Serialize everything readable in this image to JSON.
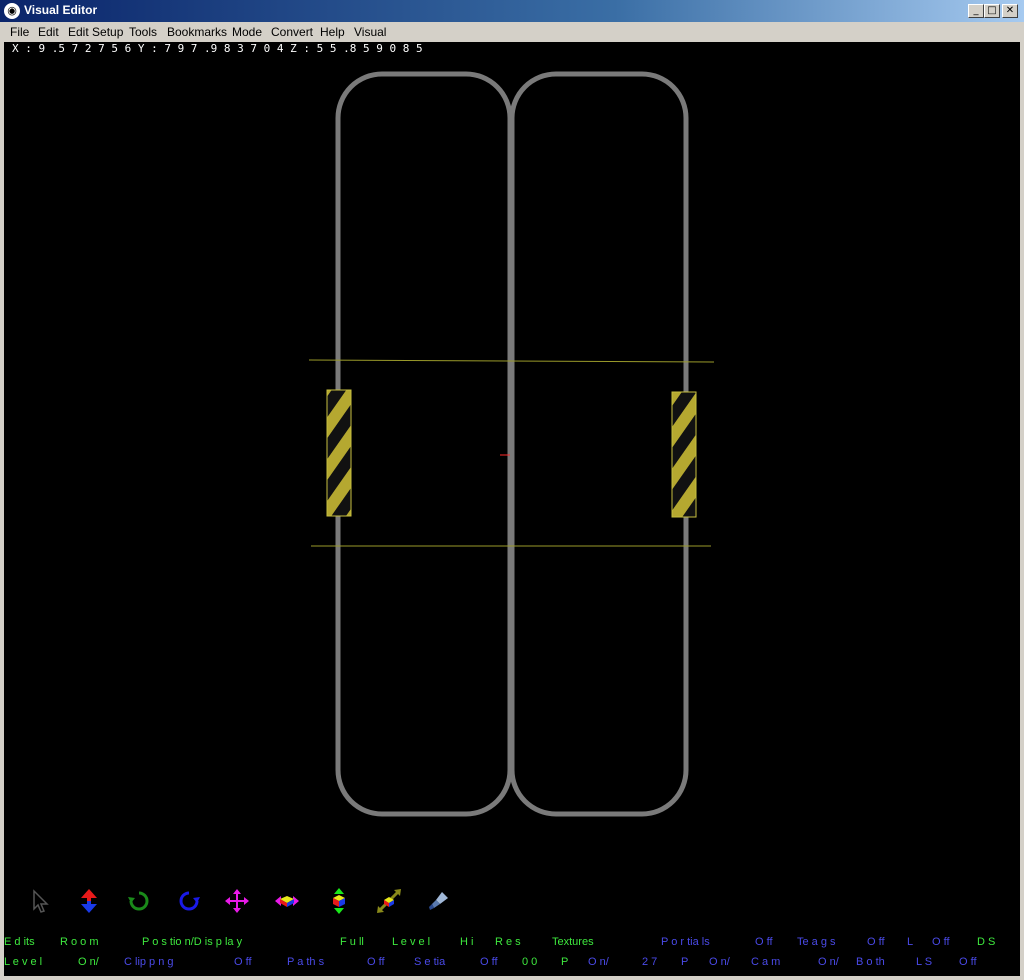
{
  "window": {
    "title": "Visual Editor",
    "minimize": "_",
    "maximize": "□",
    "close": "✕"
  },
  "menu": [
    "File",
    "Edit",
    "Edit Setup",
    "Tools",
    "Bookmarks",
    "Mode",
    "Convert",
    "Help",
    "Visual"
  ],
  "coords": "X : 9 .5 7 2 7 5 6 Y : 7 9 7 .9 8 3 7 0 4 Z : 5 5 .8 5 9 0 8 5",
  "toolbar_icons": [
    "select-arrow-icon",
    "move-vertical-icon",
    "rotate-cw-icon",
    "rotate-ccw-icon",
    "move-all-icon",
    "move-horizontal-icon",
    "move-depth-icon",
    "scale-icon",
    "paint-icon"
  ],
  "status_row1": [
    {
      "text": "E d  its",
      "color": "green"
    },
    {
      "text": "R  o  o  m",
      "color": "green"
    },
    {
      "text": "P  o  s  tio  n/D  is  p  la  y",
      "color": "green"
    },
    {
      "text": "F  u  ll",
      "color": "green"
    },
    {
      "text": "L  e  v  e  l",
      "color": "green"
    },
    {
      "text": "H  i",
      "color": "green"
    },
    {
      "text": "R  e  s",
      "color": "green"
    },
    {
      "text": "Textures",
      "color": "green"
    },
    {
      "text": "P  o  r  tia  ls",
      "color": "blue"
    },
    {
      "text": "O  ff",
      "color": "blue"
    },
    {
      "text": "Te  a  g  s",
      "color": "blue"
    },
    {
      "text": "O  ff",
      "color": "blue"
    },
    {
      "text": "L",
      "color": "blue"
    },
    {
      "text": "O  ff",
      "color": "blue"
    },
    {
      "text": "D  S",
      "color": "green"
    }
  ],
  "status_row2": [
    {
      "text": "L  e  v  e  l",
      "color": "green"
    },
    {
      "text": "O  n/",
      "color": "green"
    },
    {
      "text": "C  lip  p  n  g",
      "color": "blue"
    },
    {
      "text": "O  ff",
      "color": "blue"
    },
    {
      "text": "P  a  th  s",
      "color": "blue"
    },
    {
      "text": "O  ff",
      "color": "blue"
    },
    {
      "text": "S  e  tia",
      "color": "blue"
    },
    {
      "text": "O  ff",
      "color": "blue"
    },
    {
      "text": "0 0",
      "color": "green"
    },
    {
      "text": "P",
      "color": "green"
    },
    {
      "text": "O  n/",
      "color": "blue"
    },
    {
      "text": "2 7",
      "color": "blue"
    },
    {
      "text": "P",
      "color": "blue"
    },
    {
      "text": "O  n/",
      "color": "blue"
    },
    {
      "text": "C  a  m",
      "color": "blue"
    },
    {
      "text": "O  n/",
      "color": "blue"
    },
    {
      "text": "B  o  th",
      "color": "blue"
    },
    {
      "text": "L  S",
      "color": "blue"
    },
    {
      "text": "O  ff",
      "color": "blue"
    }
  ]
}
